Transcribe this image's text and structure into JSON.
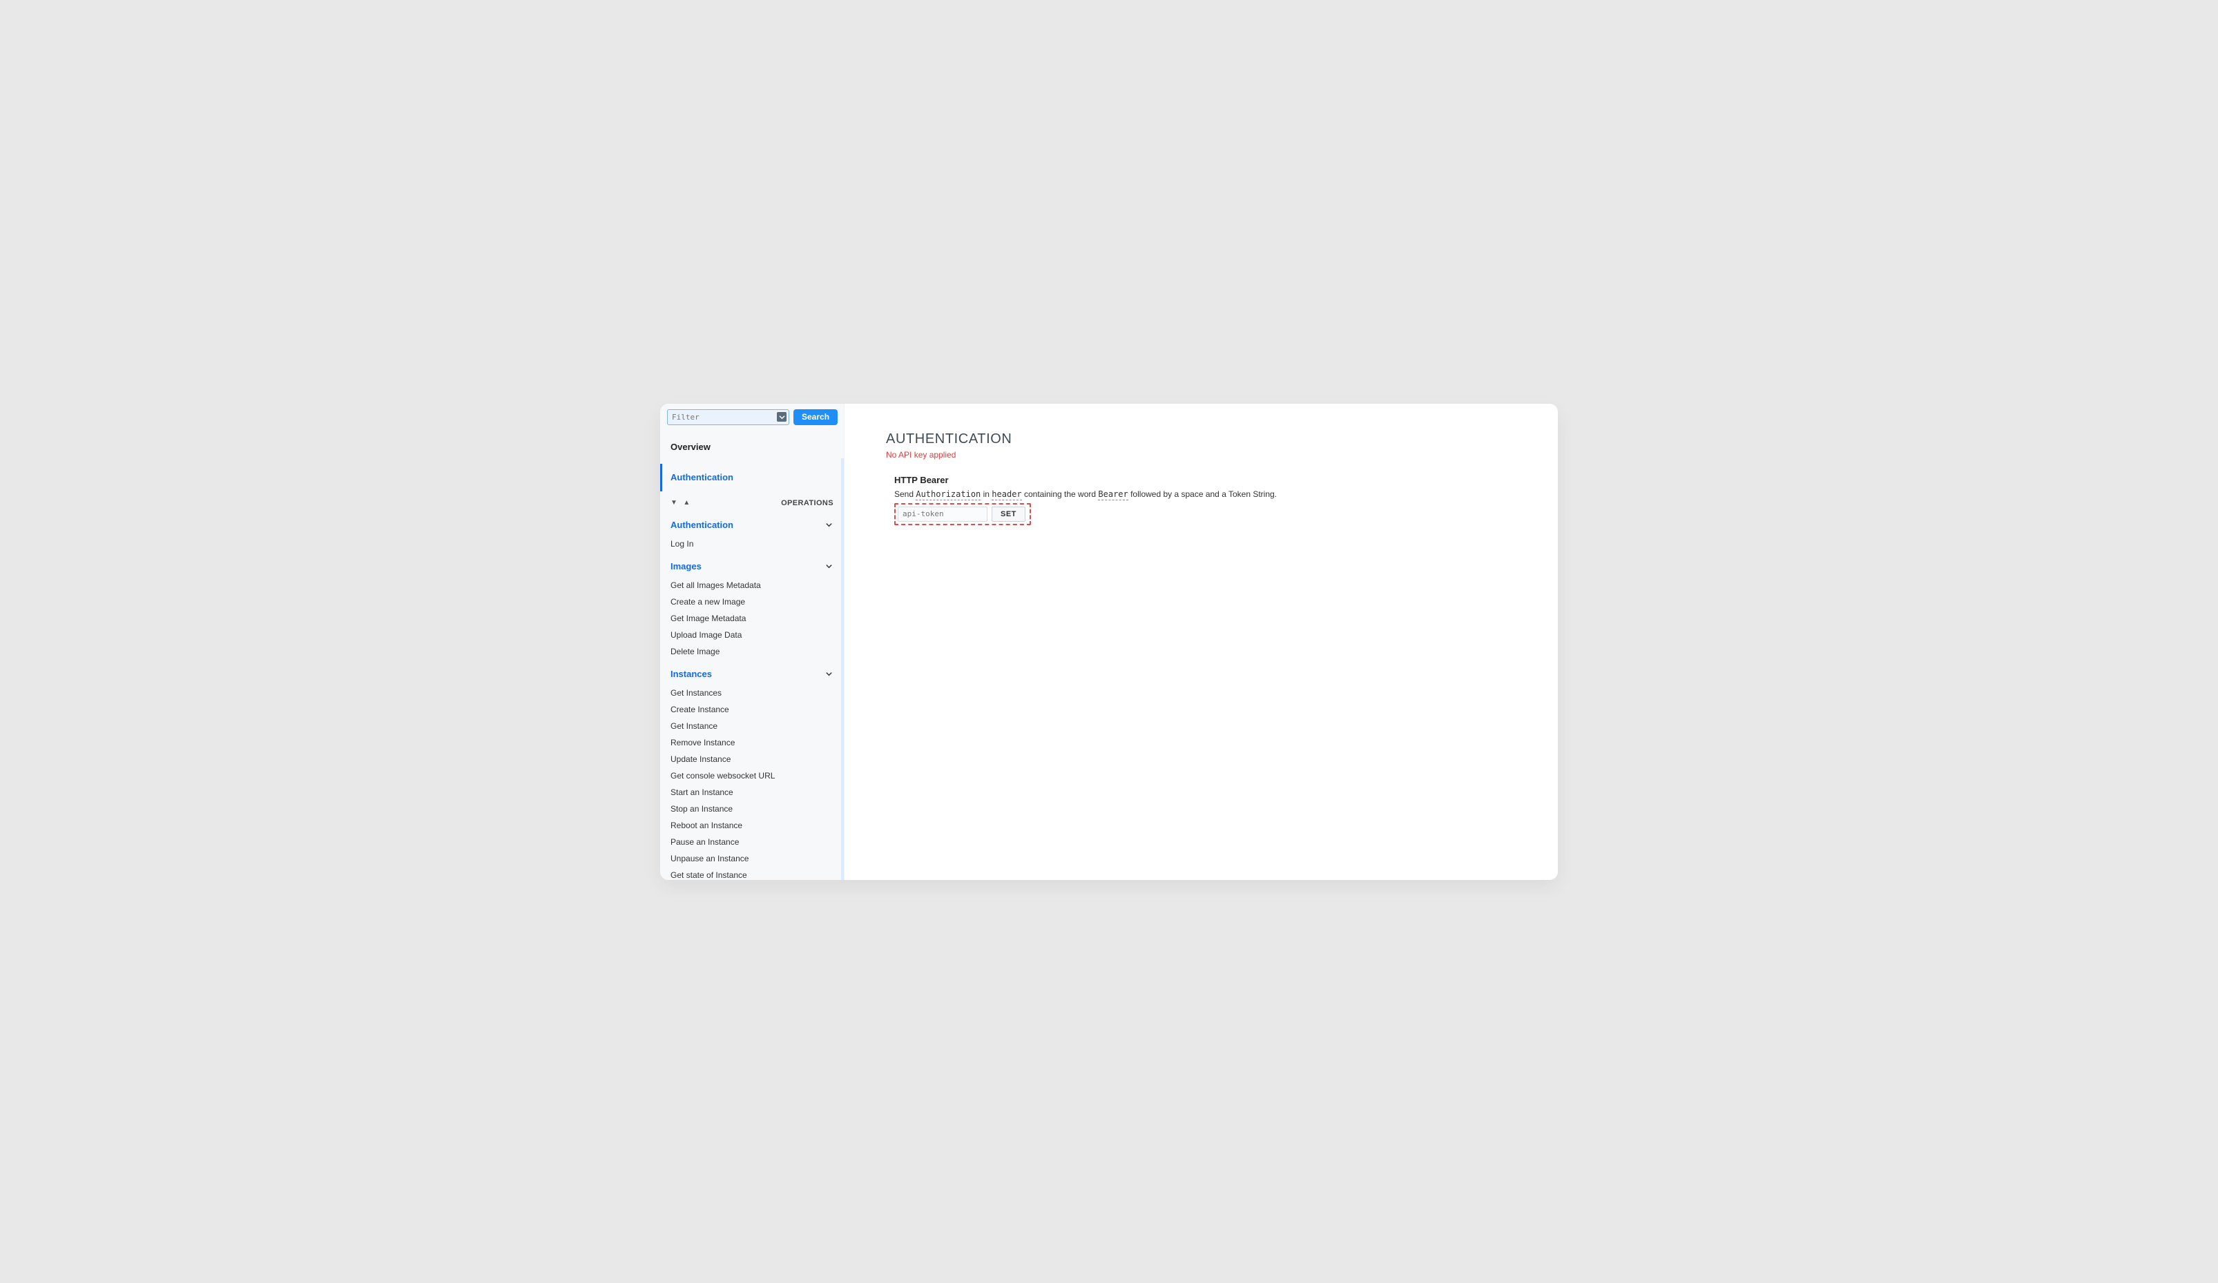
{
  "search": {
    "placeholder": "Filter",
    "button": "Search"
  },
  "sidebar": {
    "overview": "Overview",
    "active": "Authentication",
    "operations_label": "OPERATIONS",
    "collapse_arrow_down": "▼",
    "collapse_arrow_up": "▲",
    "sections": [
      {
        "title": "Authentication",
        "items": [
          "Log In"
        ]
      },
      {
        "title": "Images",
        "items": [
          "Get all Images Metadata",
          "Create a new Image",
          "Get Image Metadata",
          "Upload Image Data",
          "Delete Image"
        ]
      },
      {
        "title": "Instances",
        "items": [
          "Get Instances",
          "Create Instance",
          "Get Instance",
          "Remove Instance",
          "Update Instance",
          "Get console websocket URL",
          "Start an Instance",
          "Stop an Instance",
          "Reboot an Instance",
          "Pause an Instance",
          "Unpause an Instance",
          "Get state of Instance"
        ]
      }
    ]
  },
  "main": {
    "title": "AUTHENTICATION",
    "no_key": "No API key applied",
    "bearer_title": "HTTP Bearer",
    "desc_prefix": "Send ",
    "desc_code1": "Authorization",
    "desc_mid1": " in ",
    "desc_code2": "header",
    "desc_mid2": " containing the word ",
    "desc_code3": "Bearer",
    "desc_suffix": " followed by a space and a Token String.",
    "token_placeholder": "api-token",
    "set_button": "SET"
  }
}
